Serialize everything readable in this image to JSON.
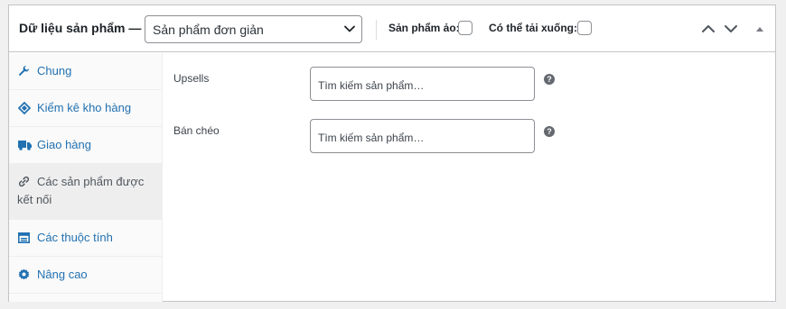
{
  "header": {
    "title": "Dữ liệu sản phẩm —",
    "product_type": {
      "selected": "Sản phẩm đơn giản"
    },
    "virtual_label": "Sản phẩm ảo:",
    "downloadable_label": "Có thể tải xuống:"
  },
  "sidebar": {
    "items": [
      {
        "label": "Chung",
        "icon": "wrench-icon"
      },
      {
        "label": "Kiểm kê kho hàng",
        "icon": "tag-icon"
      },
      {
        "label": "Giao hàng",
        "icon": "truck-icon"
      },
      {
        "label": "Các sản phẩm được kết nối",
        "icon": "link-icon",
        "active": true
      },
      {
        "label": "Các thuộc tính",
        "icon": "list-view-icon"
      },
      {
        "label": "Nâng cao",
        "icon": "gear-icon"
      }
    ]
  },
  "main": {
    "fields": [
      {
        "label": "Upsells",
        "placeholder": "Tìm kiếm sản phẩm…"
      },
      {
        "label": "Bán chéo",
        "placeholder": "Tìm kiếm sản phẩm…"
      }
    ]
  },
  "colors": {
    "link": "#2271b1",
    "border": "#c3c4c7",
    "active_tab_bg": "#eeeeee"
  }
}
